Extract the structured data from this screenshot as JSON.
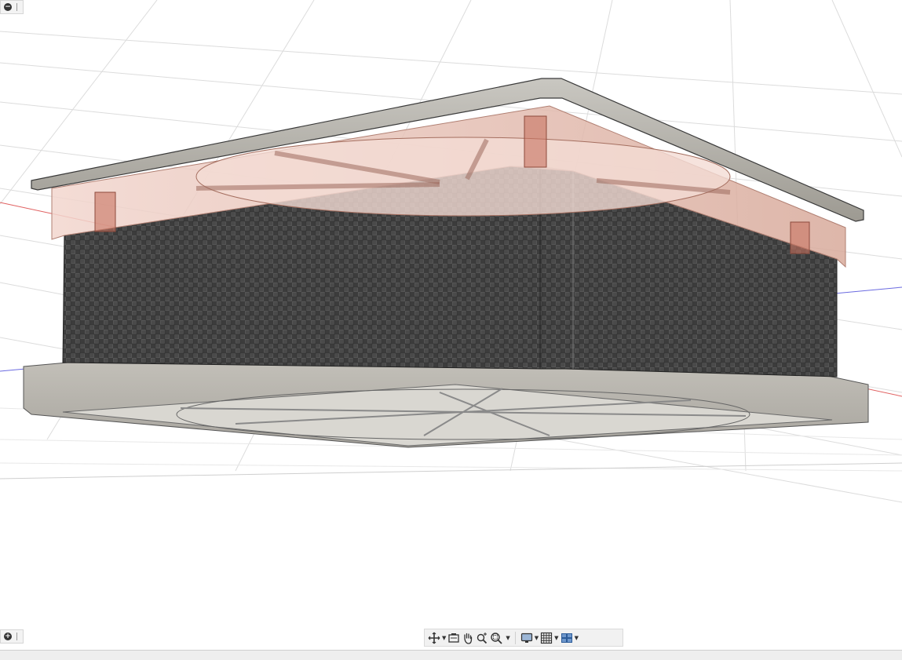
{
  "viewport": {
    "background": "#ffffff",
    "grid_color": "#d9d9d9",
    "axis_x_color": "#e06060",
    "axis_z_color": "#6a6ae0",
    "model": {
      "shell_material": "carbon-fiber-weave",
      "frame_color": "#b7b4ac",
      "fan_color": "#c98f80"
    }
  },
  "corner_controls": {
    "top": {
      "icon": "minus-circle-icon"
    },
    "bottom": {
      "icon": "plus-circle-icon"
    }
  },
  "nav_toolbar": {
    "buttons": [
      {
        "name": "orbit",
        "icon": "orbit-icon",
        "dropdown": true
      },
      {
        "name": "look-at",
        "icon": "look-at-icon",
        "dropdown": false
      },
      {
        "name": "pan",
        "icon": "pan-hand-icon",
        "dropdown": false
      },
      {
        "name": "zoom",
        "icon": "zoom-icon",
        "dropdown": false
      },
      {
        "name": "fit",
        "icon": "zoom-window-icon",
        "dropdown": true
      },
      {
        "name": "display-settings",
        "icon": "display-monitor-icon",
        "dropdown": true
      },
      {
        "name": "grid-snaps",
        "icon": "grid-icon",
        "dropdown": true
      },
      {
        "name": "viewports",
        "icon": "viewports-icon",
        "dropdown": true
      }
    ]
  }
}
